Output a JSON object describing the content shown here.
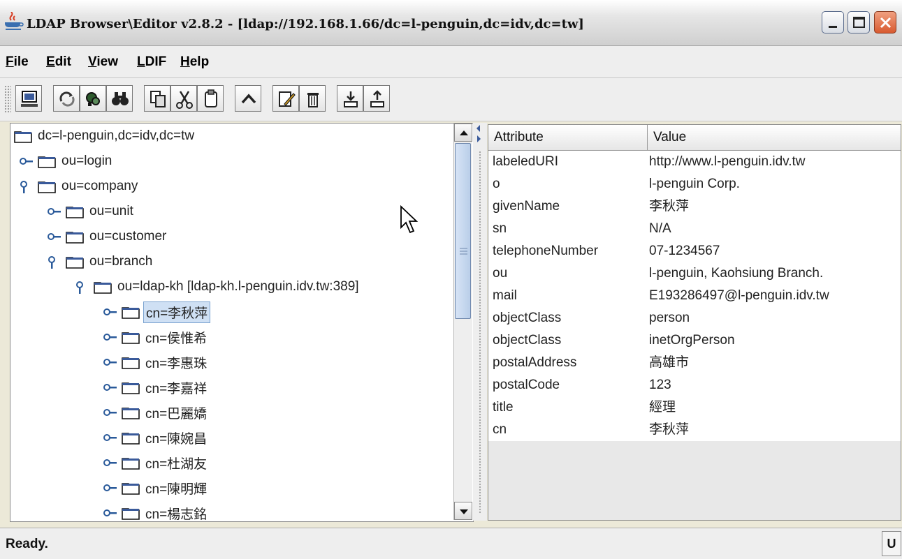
{
  "window": {
    "title": "LDAP Browser\\Editor v2.8.2 - [ldap://192.168.1.66/dc=l-penguin,dc=idv,dc=tw]",
    "app_icon": "java-coffee-cup-icon",
    "controls": [
      "minimize-icon",
      "maximize-icon",
      "close-icon"
    ]
  },
  "menu": {
    "items": [
      {
        "label": "File"
      },
      {
        "label": "Edit"
      },
      {
        "label": "View"
      },
      {
        "label": "LDIF"
      },
      {
        "label": "Help"
      }
    ]
  },
  "toolbar": {
    "buttons": [
      {
        "name": "connect",
        "icon": "computer-icon"
      },
      {
        "name": "refresh",
        "icon": "refresh-icon"
      },
      {
        "name": "search",
        "icon": "search-icon"
      },
      {
        "name": "find",
        "icon": "binoculars-icon"
      },
      {
        "name": "copy",
        "icon": "copy-icon"
      },
      {
        "name": "cut",
        "icon": "scissors-icon"
      },
      {
        "name": "paste",
        "icon": "clipboard-icon"
      },
      {
        "name": "up",
        "icon": "chevron-up-icon"
      },
      {
        "name": "edit",
        "icon": "edit-icon"
      },
      {
        "name": "delete",
        "icon": "trash-icon"
      },
      {
        "name": "export",
        "icon": "export-icon"
      },
      {
        "name": "import",
        "icon": "import-icon"
      }
    ]
  },
  "tree": {
    "nodes": [
      {
        "label": "dc=l-penguin,dc=idv,dc=tw",
        "handle": "none",
        "selected": false
      },
      {
        "label": "ou=login",
        "handle": "collapsed",
        "selected": false
      },
      {
        "label": "ou=company",
        "handle": "expanded",
        "selected": false
      },
      {
        "label": "ou=unit",
        "handle": "collapsed",
        "selected": false
      },
      {
        "label": "ou=customer",
        "handle": "collapsed",
        "selected": false
      },
      {
        "label": "ou=branch",
        "handle": "expanded",
        "selected": false
      },
      {
        "label": "ou=ldap-kh [ldap-kh.l-penguin.idv.tw:389]",
        "handle": "expanded",
        "selected": false
      },
      {
        "label": "cn=李秋萍",
        "handle": "collapsed",
        "selected": true
      },
      {
        "label": "cn=侯惟希",
        "handle": "collapsed",
        "selected": false
      },
      {
        "label": "cn=李惠珠",
        "handle": "collapsed",
        "selected": false
      },
      {
        "label": "cn=李嘉祥",
        "handle": "collapsed",
        "selected": false
      },
      {
        "label": "cn=巴麗嬌",
        "handle": "collapsed",
        "selected": false
      },
      {
        "label": "cn=陳婉昌",
        "handle": "collapsed",
        "selected": false
      },
      {
        "label": "cn=杜湖友",
        "handle": "collapsed",
        "selected": false
      },
      {
        "label": "cn=陳明輝",
        "handle": "collapsed",
        "selected": false
      },
      {
        "label": "cn=楊志銘",
        "handle": "collapsed",
        "selected": false
      }
    ],
    "scroll_position": 0.0,
    "scroll_visible_fraction": 0.47
  },
  "attributes": {
    "columns": [
      "Attribute",
      "Value"
    ],
    "rows": [
      {
        "attribute": "labeledURI",
        "value": "http://www.l-penguin.idv.tw"
      },
      {
        "attribute": "o",
        "value": "l-penguin Corp."
      },
      {
        "attribute": "givenName",
        "value": "李秋萍"
      },
      {
        "attribute": "sn",
        "value": "N/A"
      },
      {
        "attribute": "telephoneNumber",
        "value": "07-1234567"
      },
      {
        "attribute": "ou",
        "value": "l-penguin, Kaohsiung Branch."
      },
      {
        "attribute": "mail",
        "value": "E193286497@l-penguin.idv.tw"
      },
      {
        "attribute": "objectClass",
        "value": "person"
      },
      {
        "attribute": "objectClass",
        "value": "inetOrgPerson"
      },
      {
        "attribute": "postalAddress",
        "value": "高雄市"
      },
      {
        "attribute": "postalCode",
        "value": "123"
      },
      {
        "attribute": "title",
        "value": "經理"
      },
      {
        "attribute": "cn",
        "value": "李秋萍"
      }
    ]
  },
  "status": {
    "text": "Ready.",
    "indicator": "U"
  },
  "colors": {
    "selection_bg": "#cfe0f4",
    "scroll_thumb": "#b9cee9",
    "close_button": "#d85a30"
  }
}
